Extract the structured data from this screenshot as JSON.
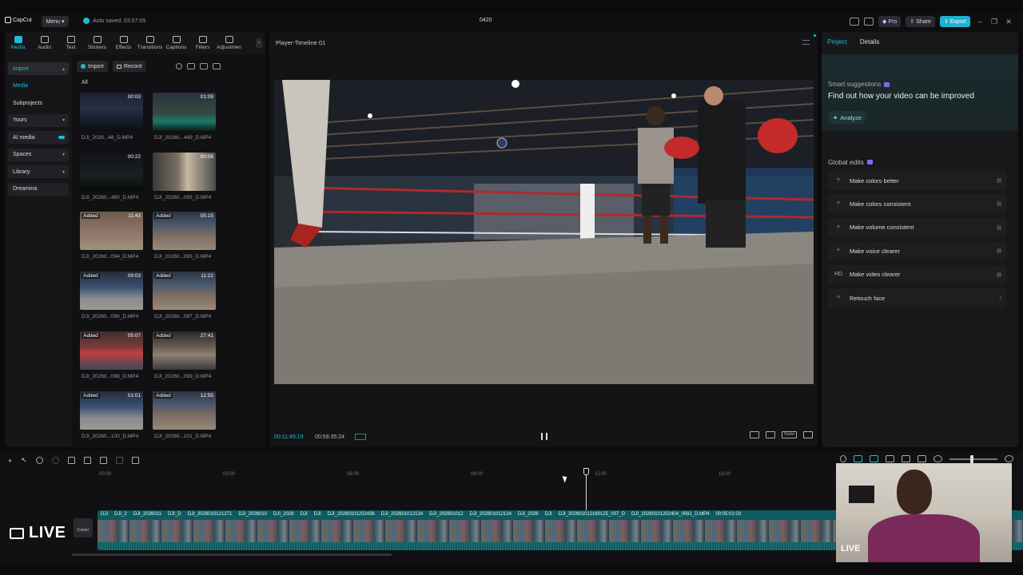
{
  "titlebar": {
    "logo": "CapCut",
    "menu": "Menu",
    "autosave": "Auto saved: 03:57:09",
    "project_title": "0420",
    "pro": "Pro",
    "share": "Share",
    "export": "Export"
  },
  "toolstrip": [
    {
      "label": "Media",
      "icon": "media-icon",
      "active": true
    },
    {
      "label": "Audio",
      "icon": "audio-icon"
    },
    {
      "label": "Text",
      "icon": "text-icon"
    },
    {
      "label": "Stickers",
      "icon": "sticker-icon"
    },
    {
      "label": "Effects",
      "icon": "effects-icon"
    },
    {
      "label": "Transitions",
      "icon": "transitions-icon"
    },
    {
      "label": "Captions",
      "icon": "captions-icon"
    },
    {
      "label": "Filters",
      "icon": "filters-icon"
    },
    {
      "label": "Adjustmen",
      "icon": "adjustment-icon"
    }
  ],
  "leftnav": {
    "import": "Import",
    "media": "Media",
    "subprojects": "Subprojects",
    "yours": "Yours",
    "ai_media": "AI media",
    "spaces": "Spaces",
    "library": "Library",
    "dreamina": "Dreamina"
  },
  "media": {
    "import_btn": "Import",
    "record_btn": "Record",
    "filter_all": "All",
    "items": [
      {
        "name": "DJI_2026...48_D.MP4",
        "duration": "00:03",
        "added": false
      },
      {
        "name": "DJI_20260...449_D.MP4",
        "duration": "01:09",
        "added": false
      },
      {
        "name": "DJI_20260...450_D.MP4",
        "duration": "00:22",
        "added": false
      },
      {
        "name": "DJI_20260...093_D.MP4",
        "duration": "00:08",
        "added": false
      },
      {
        "name": "DJI_20260...094_D.MP4",
        "duration": "11:43",
        "added": true
      },
      {
        "name": "DJI_20260...095_D.MP4",
        "duration": "05:15",
        "added": true
      },
      {
        "name": "DJI_20260...096_D.MP4",
        "duration": "09:03",
        "added": true
      },
      {
        "name": "DJI_20260...097_D.MP4",
        "duration": "11:22",
        "added": true
      },
      {
        "name": "DJI_20260...098_D.MP4",
        "duration": "05:07",
        "added": true
      },
      {
        "name": "DJI_20260...099_D.MP4",
        "duration": "27:41",
        "added": true
      },
      {
        "name": "DJI_20260...100_D.MP4",
        "duration": "01:01",
        "added": true
      },
      {
        "name": "DJI_20260...101_D.MP4",
        "duration": "12:55",
        "added": true
      }
    ],
    "added_label": "Added"
  },
  "player": {
    "title": "Player-Timeline 01",
    "current_time": "00:11:49:19",
    "total_time": "00:59:35:24",
    "ratio_label": "Ratio"
  },
  "rightpanel": {
    "tab_project": "Project",
    "tab_details": "Details",
    "smart_suggestions": "Smart suggestions",
    "suggestion_title": "Find out how your video can be improved",
    "analyze": "Analyze",
    "global_edits": "Global edits",
    "edits": [
      {
        "label": "Make colors better",
        "icon": "colors-icon"
      },
      {
        "label": "Make colors consistent",
        "icon": "consistent-icon"
      },
      {
        "label": "Make volume consistent",
        "icon": "volume-icon"
      },
      {
        "label": "Make voice clearer",
        "icon": "voice-icon"
      },
      {
        "label": "Make video clearer",
        "icon": "hd-icon"
      },
      {
        "label": "Retouch face",
        "icon": "retouch-icon"
      }
    ],
    "hd_text": "HD"
  },
  "timeline": {
    "ticks": [
      "00:00",
      "03:00",
      "06:00",
      "09:00",
      "12:00",
      "15:00"
    ],
    "track_labels": [
      "DJI",
      "DJI_2",
      "DJI_2026011",
      "DJI_D",
      "DJI_2026010121271",
      "DJI_2026010",
      "DJI_2026",
      "DJI",
      "DJI",
      "DJI_20260101202436",
      "DJI_202601012134",
      "DJI_202601012",
      "DJI_202601012134",
      "DJI_2026",
      "DJI",
      "DJI_202601012160125_007_D",
      "DJI_20260101202404_0091_D.MP4",
      "00:05:01:03"
    ],
    "cover": "Cover"
  },
  "overlay": {
    "live_left": "LIVE",
    "live_cam": "LIVE"
  }
}
